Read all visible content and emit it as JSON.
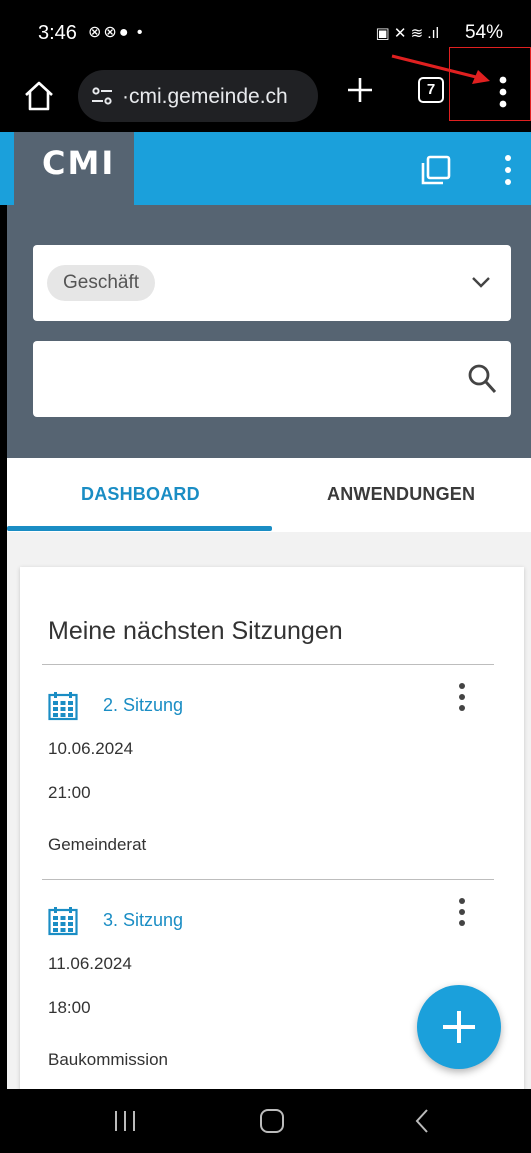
{
  "status_bar": {
    "time": "3:46",
    "left_icons": "⊗⊗● •",
    "right_icons": "▣ ✕ ≋ .ıl",
    "battery": "54%"
  },
  "browser": {
    "url": "·cmi.gemeinde.ch",
    "tab_count": "7",
    "icons": [
      "home-icon",
      "site-settings-icon",
      "new-tab-icon",
      "tab-switcher-icon",
      "more-vert-icon"
    ]
  },
  "app": {
    "logo": "CMI",
    "header_icons": [
      "windows-icon",
      "more-vert-icon"
    ]
  },
  "search": {
    "filter_chip": "Geschäft",
    "search_placeholder": ""
  },
  "tabs": [
    {
      "label": "DASHBOARD",
      "active": true
    },
    {
      "label": "ANWENDUNGEN",
      "active": false
    }
  ],
  "card": {
    "title": "Meine nächsten Sitzungen",
    "items": [
      {
        "title": "2. Sitzung",
        "date": "10.06.2024",
        "time": "21:00",
        "body": "Gemeinderat"
      },
      {
        "title": "3. Sitzung",
        "date": "11.06.2024",
        "time": "18:00",
        "body": "Baukommission"
      }
    ]
  },
  "colors": {
    "accent": "#1ba0db",
    "header_dark": "#566472",
    "link": "#1a8dc4",
    "annotation": "#e02020"
  }
}
